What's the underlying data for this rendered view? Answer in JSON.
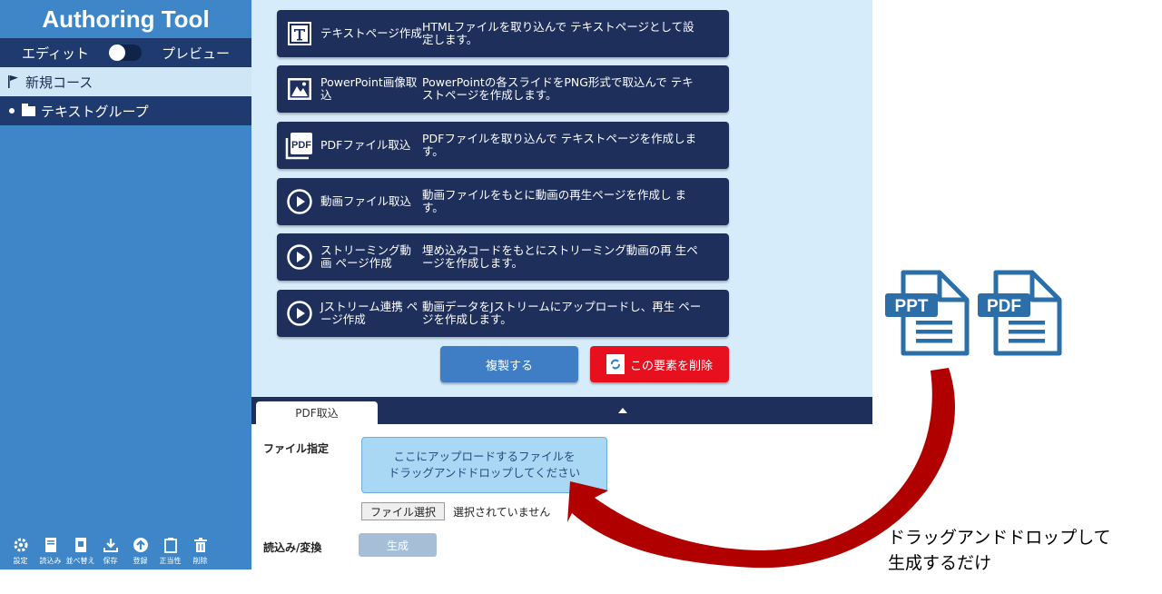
{
  "app": {
    "title": "Authoring Tool"
  },
  "mode": {
    "edit_label": "エディット",
    "preview_label": "プレビュー"
  },
  "tree": {
    "course_label": "新規コース",
    "group_label": "テキストグループ"
  },
  "toolbar": {
    "items": [
      {
        "label": "設定",
        "icon": "gear-icon"
      },
      {
        "label": "読込み",
        "icon": "book-icon"
      },
      {
        "label": "並べ替え",
        "icon": "sort-icon"
      },
      {
        "label": "保存",
        "icon": "download-icon"
      },
      {
        "label": "登録",
        "icon": "upload-icon"
      },
      {
        "label": "正当性",
        "icon": "clipboard-icon"
      },
      {
        "label": "削除",
        "icon": "trash-icon"
      }
    ]
  },
  "features": [
    {
      "title": "テキストページ作成",
      "desc": "HTMLファイルを取り込んで テキストページとして設定します。",
      "icon": "text-icon"
    },
    {
      "title": "PowerPoint画像取込",
      "desc": "PowerPointの各スライドをPNG形式で取込んで テキストページを作成します。",
      "icon": "image-icon"
    },
    {
      "title": "PDFファイル取込",
      "desc": "PDFファイルを取り込んで テキストページを作成します。",
      "icon": "pdf-icon"
    },
    {
      "title": "動画ファイル取込",
      "desc": "動画ファイルをもとに動画の再生ページを作成し ます。",
      "icon": "play-icon"
    },
    {
      "title": "ストリーミング動画 ページ作成",
      "desc": "埋め込みコードをもとにストリーミング動画の再 生ページを作成します。",
      "icon": "play-icon"
    },
    {
      "title": "Jストリーム連携 ページ作成",
      "desc": "動画データをJストリームにアップロードし、再生 ページを作成します。",
      "icon": "play-icon"
    }
  ],
  "actions": {
    "duplicate_label": "複製する",
    "delete_label": "この要素を削除"
  },
  "panel": {
    "tab_label": "PDF取込",
    "file_label": "ファイル指定",
    "drop_line1": "ここにアップロードするファイルを",
    "drop_line2": "ドラッグアンドドロップしてください",
    "file_button": "ファイル選択",
    "file_status": "選択されていません",
    "convert_label": "読込み/変換",
    "generate_button": "生成"
  },
  "annotation": {
    "line1": "ドラッグアンドドロップして",
    "line2": "生成するだけ",
    "doc1_label": "PPT",
    "doc2_label": "PDF",
    "arrow_color": "#b00000",
    "doc_color": "#2b6ea8"
  }
}
